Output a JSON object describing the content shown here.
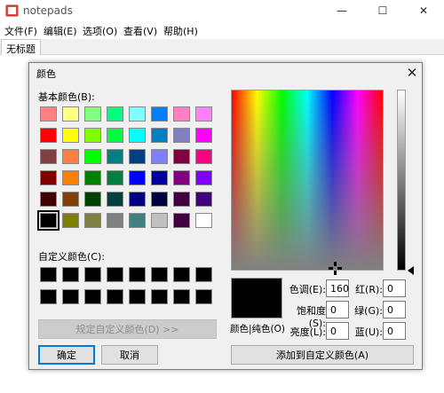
{
  "window": {
    "title": "notepads",
    "minimize": "—",
    "maximize": "☐",
    "close": "✕"
  },
  "menu": [
    "文件(F)",
    "编辑(E)",
    "选项(O)",
    "查看(V)",
    "帮助(H)"
  ],
  "tab": {
    "label": "无标题"
  },
  "dialog": {
    "title": "颜色",
    "basic_colors_label": "基本颜色(B):",
    "custom_colors_label": "自定义颜色(C):",
    "define_custom_button": "规定自定义颜色(D) >>",
    "ok_button": "确定",
    "cancel_button": "取消",
    "preview_label": "颜色|纯色(O)",
    "add_custom_button": "添加到自定义颜色(A)",
    "hue_label": "色调(E):",
    "hue_value": "160",
    "sat_label": "饱和度(S):",
    "sat_value": "0",
    "lum_label": "亮度(L):",
    "lum_value": "0",
    "red_label": "红(R):",
    "red_value": "0",
    "green_label": "绿(G):",
    "green_value": "0",
    "blue_label": "蓝(U):",
    "blue_value": "0",
    "basic_colors": [
      [
        "#ff8080",
        "#ffff80",
        "#80ff80",
        "#00ff80",
        "#80ffff",
        "#0080ff",
        "#ff80c0",
        "#ff80ff"
      ],
      [
        "#ff0000",
        "#ffff00",
        "#80ff00",
        "#00ff40",
        "#00ffff",
        "#0080c0",
        "#8080c0",
        "#ff00ff"
      ],
      [
        "#804040",
        "#ff8040",
        "#00ff00",
        "#008080",
        "#004080",
        "#8080ff",
        "#800040",
        "#ff0080"
      ],
      [
        "#800000",
        "#ff8000",
        "#008000",
        "#008040",
        "#0000ff",
        "#0000a0",
        "#800080",
        "#8000ff"
      ],
      [
        "#400000",
        "#804000",
        "#004000",
        "#004040",
        "#000080",
        "#000040",
        "#400040",
        "#400080"
      ],
      [
        "#000000",
        "#808000",
        "#808040",
        "#808080",
        "#408080",
        "#c0c0c0",
        "#400040",
        "#ffffff"
      ]
    ],
    "selected_color": "#000000"
  }
}
